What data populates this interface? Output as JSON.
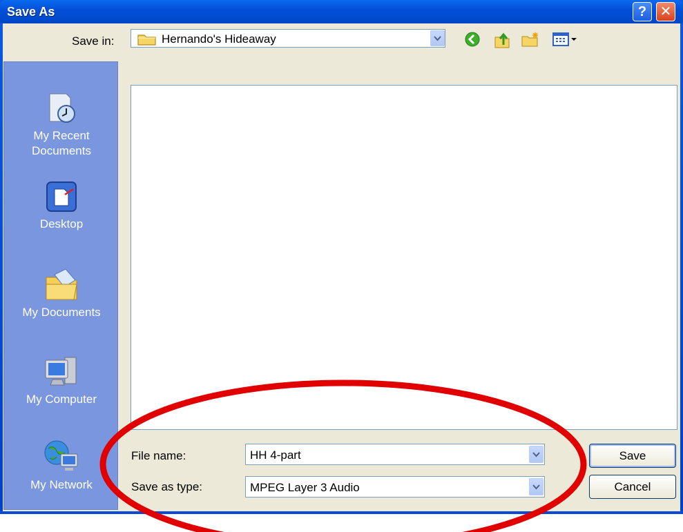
{
  "window": {
    "title": "Save As",
    "help_label": "?",
    "close_label": "✕"
  },
  "save_in": {
    "label": "Save in:",
    "value": "Hernando's Hideaway"
  },
  "toolbar": {
    "icons": [
      "back-icon",
      "up-folder-icon",
      "new-folder-icon",
      "view-menu-icon"
    ]
  },
  "places": [
    {
      "label": "My Recent Documents",
      "icon": "recent-documents-icon"
    },
    {
      "label": "Desktop",
      "icon": "desktop-icon"
    },
    {
      "label": "My Documents",
      "icon": "my-documents-icon"
    },
    {
      "label": "My Computer",
      "icon": "my-computer-icon"
    },
    {
      "label": "My Network",
      "icon": "my-network-icon"
    }
  ],
  "file_name": {
    "label": "File name:",
    "value": "HH 4-part"
  },
  "save_as_type": {
    "label": "Save as type:",
    "value": "MPEG Layer 3 Audio"
  },
  "buttons": {
    "save": "Save",
    "cancel": "Cancel"
  },
  "colors": {
    "titlebar": "#0350d8",
    "places_bar": "#7a96df",
    "client": "#ece9d8",
    "highlight_ellipse": "#e00000"
  }
}
